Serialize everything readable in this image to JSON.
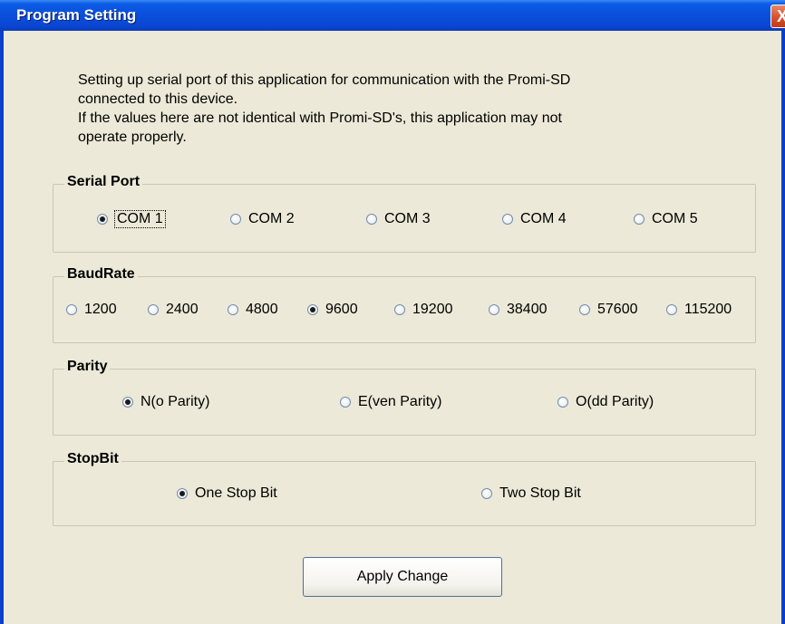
{
  "window": {
    "title": "Program Setting",
    "close_label": "X"
  },
  "description": {
    "line1": "Setting up serial port of this application for communication with the Promi-SD",
    "line2": "connected to this device.",
    "line3": "If the values here are not identical with Promi-SD's, this application may not",
    "line4": "operate properly."
  },
  "serial_port": {
    "label": "Serial Port",
    "options": [
      "COM 1",
      "COM 2",
      "COM 3",
      "COM 4",
      "COM 5"
    ],
    "selected": "COM 1"
  },
  "baud_rate": {
    "label": "BaudRate",
    "options": [
      "1200",
      "2400",
      "4800",
      "9600",
      "19200",
      "38400",
      "57600",
      "115200"
    ],
    "selected": "9600"
  },
  "parity": {
    "label": "Parity",
    "options": [
      "N(o Parity)",
      "E(ven Parity)",
      "O(dd Parity)"
    ],
    "selected": "N(o Parity)"
  },
  "stop_bit": {
    "label": "StopBit",
    "options": [
      "One Stop Bit",
      "Two Stop Bit"
    ],
    "selected": "One Stop Bit"
  },
  "apply_label": "Apply Change",
  "colors": {
    "titlebar": "#0A4FDB",
    "background": "#ECE9D8",
    "close": "#D8512E"
  }
}
